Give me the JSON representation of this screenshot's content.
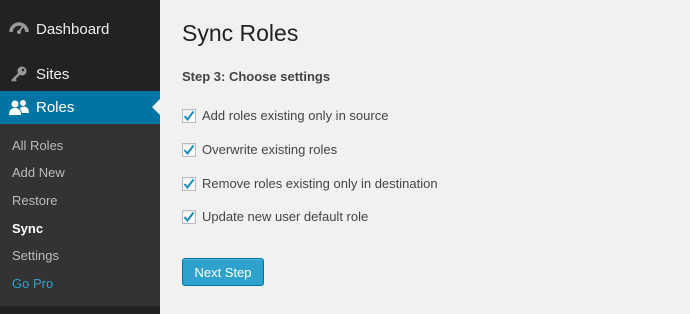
{
  "sidebar": {
    "menu": {
      "dashboard": "Dashboard",
      "sites": "Sites",
      "roles": "Roles"
    },
    "submenu": [
      "All Roles",
      "Add New",
      "Restore",
      "Sync",
      "Settings",
      "Go Pro"
    ],
    "current_item": "Sync"
  },
  "main": {
    "title": "Sync Roles",
    "step_heading": "Step 3: Choose settings",
    "options": [
      {
        "label": "Add roles existing only in source",
        "checked": true
      },
      {
        "label": "Overwrite existing roles",
        "checked": true
      },
      {
        "label": "Remove roles existing only in destination",
        "checked": true
      },
      {
        "label": "Update new user default role",
        "checked": true
      }
    ],
    "next_button": "Next Step"
  },
  "colors": {
    "sidebar_bg": "#222222",
    "submenu_bg": "#333333",
    "active_menu": "#0074a2",
    "primary_button": "#2ea2cc",
    "go_pro_link": "#2ea2cc",
    "page_bg": "#f1f1f1"
  },
  "icons": {
    "dashboard": "dashboard-gauge-icon",
    "sites": "key-icon",
    "roles": "users-icon",
    "checked": "checkmark-icon"
  }
}
